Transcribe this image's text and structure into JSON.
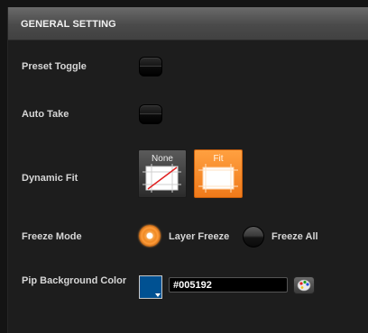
{
  "header": {
    "title": "GENERAL SETTING"
  },
  "rows": {
    "preset_toggle": {
      "label": "Preset Toggle"
    },
    "auto_take": {
      "label": "Auto Take"
    },
    "dynamic_fit": {
      "label": "Dynamic Fit",
      "options": [
        {
          "label": "None",
          "selected": false
        },
        {
          "label": "Fit",
          "selected": true
        }
      ]
    },
    "freeze_mode": {
      "label": "Freeze Mode",
      "options": [
        {
          "label": "Layer Freeze",
          "selected": true
        },
        {
          "label": "Freeze All",
          "selected": false
        }
      ]
    },
    "pip_background": {
      "label": "Pip Background Color",
      "value": "#005192",
      "swatch_color": "#005192"
    }
  },
  "colors": {
    "accent": "#f28a24",
    "header": "#555555",
    "panel": "#1d1d1d"
  },
  "icons": {
    "dropdown": "chevron-down-icon",
    "palette": "palette-icon",
    "fit_none": "no-fit-icon",
    "fit": "fit-icon"
  }
}
